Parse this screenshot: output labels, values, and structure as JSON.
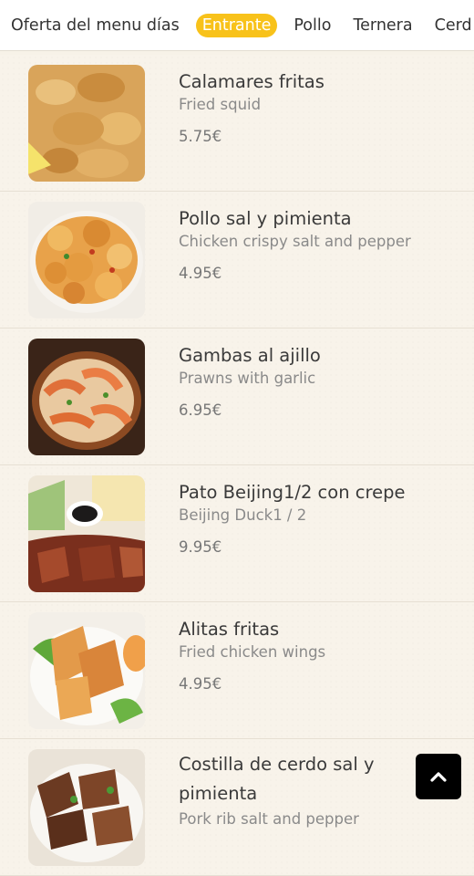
{
  "tabs": [
    "Oferta del menu días",
    "Entrante",
    "Pollo",
    "Ternera",
    "Cerd"
  ],
  "active_tab": "Entrante",
  "items": [
    {
      "name": "Calamares fritas",
      "desc": "Fried squid",
      "price": "5.75€"
    },
    {
      "name": "Pollo sal y pimienta",
      "desc": "Chicken crispy salt and pepper",
      "price": "4.95€"
    },
    {
      "name": "Gambas al ajillo",
      "desc": "Prawns with garlic",
      "price": "6.95€"
    },
    {
      "name": "Pato Beijing1/2 con crepe",
      "desc": "Beijing Duck1 / 2",
      "price": "9.95€"
    },
    {
      "name": "Alitas fritas",
      "desc": "Fried chicken wings",
      "price": "4.95€"
    },
    {
      "name": "Costilla de cerdo sal y pimienta",
      "desc": "Pork rib salt and pepper",
      "price": ""
    }
  ],
  "icons": {
    "scroll_top": "chevron-up-icon"
  }
}
